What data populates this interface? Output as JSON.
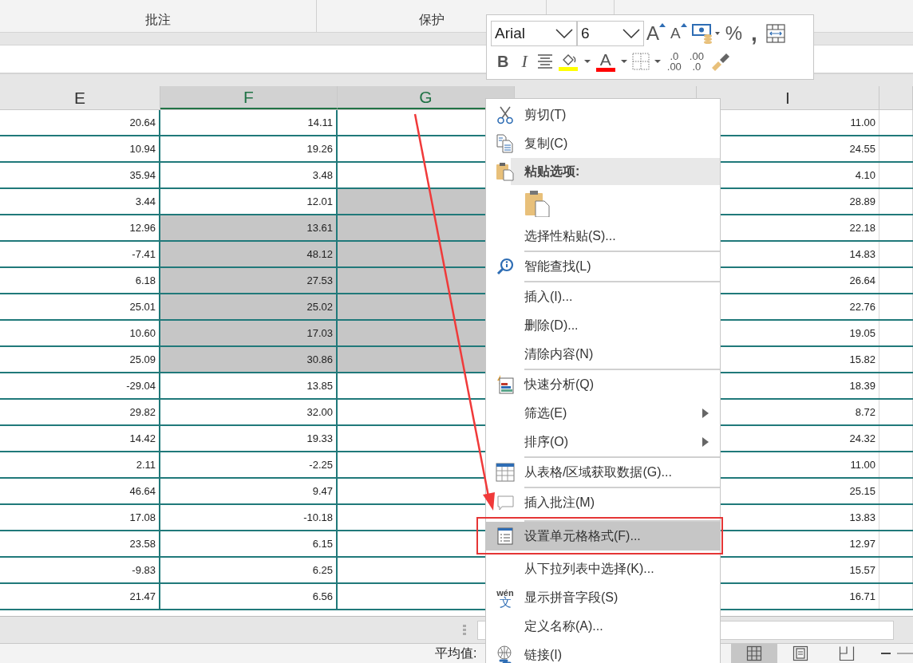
{
  "ribbon": {
    "groups": [
      {
        "label": "批注"
      },
      {
        "label": "保护"
      }
    ]
  },
  "mini_toolbar": {
    "font": "Arial",
    "size": "6",
    "row_1": [
      {
        "kind": "grow",
        "label": "A"
      },
      {
        "kind": "shrink",
        "label": "A"
      },
      {
        "kind": "currency"
      },
      {
        "kind": "percent",
        "label": "%"
      },
      {
        "kind": "comma",
        "label": ","
      },
      {
        "kind": "wrap"
      }
    ],
    "row_2": [
      {
        "kind": "bold",
        "label": "B"
      },
      {
        "kind": "italic",
        "label": "I"
      },
      {
        "kind": "align"
      },
      {
        "kind": "fill",
        "color": "#ffff00"
      },
      {
        "kind": "fontcolor",
        "label": "A",
        "color": "#ff0000"
      },
      {
        "kind": "borders"
      },
      {
        "kind": "inc_decimal",
        "lines": [
          ".0",
          ".00"
        ]
      },
      {
        "kind": "dec_decimal",
        "lines": [
          ".00",
          ".0"
        ]
      },
      {
        "kind": "painter"
      }
    ]
  },
  "columns": [
    {
      "label": "E",
      "selected": false
    },
    {
      "label": "F",
      "selected": true
    },
    {
      "label": "G",
      "selected": true
    },
    {
      "selected": false
    },
    {
      "label": "I",
      "selected": false
    }
  ],
  "rows": [
    {
      "e": "20.64",
      "f": "14.11",
      "f_selected": false,
      "g_selected": false,
      "i": "11.00"
    },
    {
      "e": "10.94",
      "f": "19.26",
      "f_selected": false,
      "g_selected": false,
      "i": "24.55"
    },
    {
      "e": "35.94",
      "f": "3.48",
      "f_selected": false,
      "g_selected": false,
      "i": "4.10"
    },
    {
      "e": "3.44",
      "f": "12.01",
      "f_selected": false,
      "g_selected": true,
      "i": "28.89"
    },
    {
      "e": "12.96",
      "f": "13.61",
      "f_selected": true,
      "g_selected": true,
      "i": "22.18"
    },
    {
      "e": "-7.41",
      "f": "48.12",
      "f_selected": true,
      "g_selected": true,
      "i": "14.83"
    },
    {
      "e": "6.18",
      "f": "27.53",
      "f_selected": true,
      "g_selected": true,
      "i": "26.64"
    },
    {
      "e": "25.01",
      "f": "25.02",
      "f_selected": true,
      "g_selected": true,
      "i": "22.76"
    },
    {
      "e": "10.60",
      "f": "17.03",
      "f_selected": true,
      "g_selected": true,
      "i": "19.05"
    },
    {
      "e": "25.09",
      "f": "30.86",
      "f_selected": true,
      "g_selected": true,
      "i": "15.82"
    },
    {
      "e": "-29.04",
      "f": "13.85",
      "f_selected": false,
      "g_selected": false,
      "i": "18.39"
    },
    {
      "e": "29.82",
      "f": "32.00",
      "f_selected": false,
      "g_selected": false,
      "i": "8.72"
    },
    {
      "e": "14.42",
      "f": "19.33",
      "f_selected": false,
      "g_selected": false,
      "i": "24.32"
    },
    {
      "e": "2.11",
      "f": "-2.25",
      "f_selected": false,
      "g_selected": false,
      "i": "11.00"
    },
    {
      "e": "46.64",
      "f": "9.47",
      "f_selected": false,
      "g_selected": false,
      "i": "25.15"
    },
    {
      "e": "17.08",
      "f": "-10.18",
      "f_selected": false,
      "g_selected": false,
      "i": "13.83"
    },
    {
      "e": "23.58",
      "f": "6.15",
      "f_selected": false,
      "g_selected": false,
      "i": "12.97"
    },
    {
      "e": "-9.83",
      "f": "6.25",
      "f_selected": false,
      "g_selected": false,
      "i": "15.57"
    },
    {
      "e": "21.47",
      "f": "6.56",
      "f_selected": false,
      "g_selected": false,
      "i": "16.71"
    }
  ],
  "context_menu": [
    {
      "kind": "item",
      "label": "剪切(T)",
      "separator_before": false,
      "submenu": false,
      "selected": false
    },
    {
      "kind": "item",
      "label": "复制(C)",
      "separator_before": false,
      "submenu": false,
      "selected": false
    },
    {
      "kind": "header",
      "label": "粘贴选项:",
      "separator_before": false,
      "submenu": false,
      "selected": false
    },
    {
      "kind": "paste_options",
      "separator_before": false,
      "submenu": false,
      "selected": false
    },
    {
      "kind": "item",
      "label": "选择性粘贴(S)...",
      "separator_before": false,
      "submenu": false,
      "selected": false
    },
    {
      "kind": "item",
      "label": "智能查找(L)",
      "separator_before": true,
      "submenu": false,
      "selected": false
    },
    {
      "kind": "item",
      "label": "插入(I)...",
      "separator_before": true,
      "submenu": false,
      "selected": false
    },
    {
      "kind": "item",
      "label": "删除(D)...",
      "separator_before": false,
      "submenu": false,
      "selected": false
    },
    {
      "kind": "item",
      "label": "清除内容(N)",
      "separator_before": false,
      "submenu": false,
      "selected": false
    },
    {
      "kind": "item",
      "label": "快速分析(Q)",
      "separator_before": true,
      "submenu": false,
      "selected": false
    },
    {
      "kind": "item",
      "label": "筛选(E)",
      "separator_before": false,
      "submenu": true,
      "selected": false
    },
    {
      "kind": "item",
      "label": "排序(O)",
      "separator_before": false,
      "submenu": true,
      "selected": false
    },
    {
      "kind": "item",
      "label": "从表格/区域获取数据(G)...",
      "separator_before": true,
      "submenu": false,
      "selected": false
    },
    {
      "kind": "item",
      "label": "插入批注(M)",
      "separator_before": true,
      "submenu": false,
      "selected": false
    },
    {
      "kind": "item",
      "label": "设置单元格格式(F)...",
      "separator_before": true,
      "submenu": false,
      "selected": true,
      "outlined": true
    },
    {
      "kind": "item",
      "label": "从下拉列表中选择(K)...",
      "separator_before": false,
      "submenu": false,
      "selected": false
    },
    {
      "kind": "item",
      "label": "显示拼音字段(S)",
      "separator_before": false,
      "submenu": false,
      "selected": false,
      "badge": [
        "wén",
        "文"
      ]
    },
    {
      "kind": "item",
      "label": "定义名称(A)...",
      "separator_before": false,
      "submenu": false,
      "selected": false
    },
    {
      "kind": "item",
      "label": "链接(I)",
      "separator_before": false,
      "submenu": false,
      "selected": false
    }
  ],
  "annotations": [
    {
      "kind": "arrow"
    }
  ],
  "status_bar": {
    "label": "平均值:",
    "views": [
      {
        "selected": true
      },
      {
        "selected": false
      },
      {
        "selected": false
      }
    ]
  }
}
